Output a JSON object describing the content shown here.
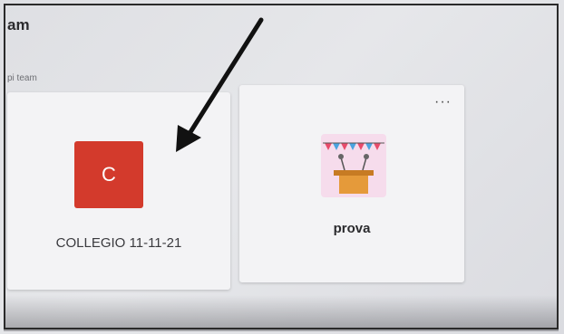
{
  "header": {
    "title": "am",
    "section_label": "pi team"
  },
  "teams": [
    {
      "name": "COLLEGIO 11-11-21",
      "avatar_letter": "C",
      "avatar_color": "#d33a2c"
    },
    {
      "name": "prova",
      "avatar_icon": "podium-celebration-icon",
      "more_icon": "more-options-icon"
    }
  ],
  "annotation": {
    "icon": "arrow-icon",
    "color": "#111111"
  }
}
